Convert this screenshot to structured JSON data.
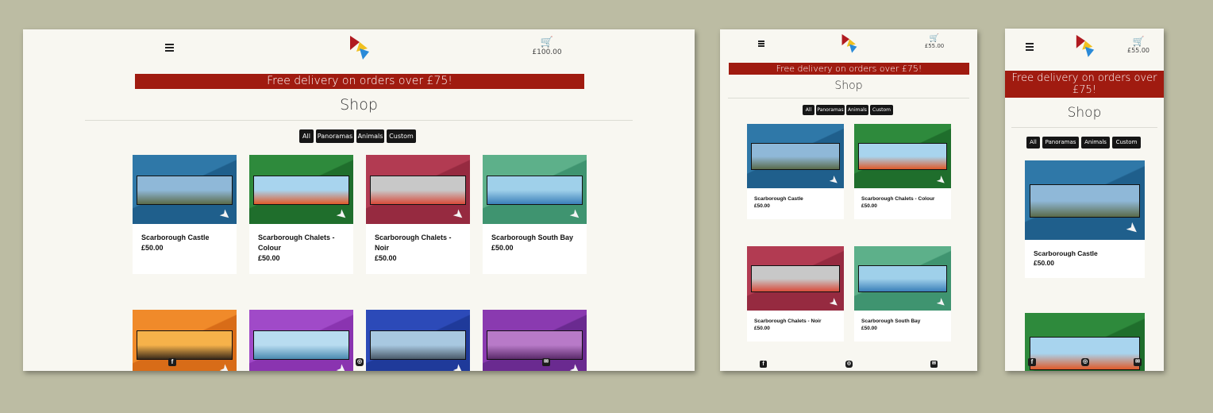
{
  "brand": {
    "logo_name": "kw-artwork-logo"
  },
  "screens": [
    {
      "id": "desktop",
      "cart_total": "£100.00",
      "banner": "Free delivery on orders over £75!",
      "title": "Shop",
      "filters": [
        "All",
        "Panoramas",
        "Animals",
        "Custom"
      ],
      "products": [
        {
          "name": "Scarborough Castle",
          "price": "£50.00",
          "bg": "#2f78a8",
          "bg2": "#1f5f8c",
          "pano_top": "#8fb8d8",
          "pano_bottom": "#5a6b4a"
        },
        {
          "name": "Scarborough Chalets - Colour",
          "price": "£50.00",
          "bg": "#2e8a3c",
          "bg2": "#1f6e2c",
          "pano_top": "#a8d4ee",
          "pano_bottom": "#e05a2a"
        },
        {
          "name": "Scarborough Chalets - Noir",
          "price": "£50.00",
          "bg": "#b23b52",
          "bg2": "#962a40",
          "pano_top": "#c8c8c8",
          "pano_bottom": "#d84a3a"
        },
        {
          "name": "Scarborough South Bay",
          "price": "£50.00",
          "bg": "#5db08a",
          "bg2": "#3f9470",
          "pano_top": "#9fd0ea",
          "pano_bottom": "#3a7fb8"
        },
        {
          "name": "",
          "price": "",
          "bg": "#f08a2a",
          "bg2": "#d86c18",
          "pano_top": "#f6b24a",
          "pano_bottom": "#3a2a1a"
        },
        {
          "name": "",
          "price": "",
          "bg": "#a04ac8",
          "bg2": "#8a34b0",
          "pano_top": "#b8dcf0",
          "pano_bottom": "#4a8ab0"
        },
        {
          "name": "",
          "price": "",
          "bg": "#2c4ab8",
          "bg2": "#1f3a9a",
          "pano_top": "#a8c8e0",
          "pano_bottom": "#4a5a6a"
        },
        {
          "name": "",
          "price": "",
          "bg": "#8a3ab0",
          "bg2": "#6a2a90",
          "pano_top": "#b87ac8",
          "pano_bottom": "#5a2a6a"
        }
      ]
    },
    {
      "id": "tablet",
      "cart_total": "£55.00",
      "banner": "Free delivery on orders over £75!",
      "title": "Shop",
      "filters": [
        "All",
        "Panoramas",
        "Animals",
        "Custom"
      ],
      "products": [
        {
          "name": "Scarborough Castle",
          "price": "£50.00",
          "bg": "#2f78a8",
          "bg2": "#1f5f8c",
          "pano_top": "#8fb8d8",
          "pano_bottom": "#5a6b4a"
        },
        {
          "name": "Scarborough Chalets - Colour",
          "price": "£50.00",
          "bg": "#2e8a3c",
          "bg2": "#1f6e2c",
          "pano_top": "#a8d4ee",
          "pano_bottom": "#e05a2a"
        },
        {
          "name": "Scarborough Chalets - Noir",
          "price": "£50.00",
          "bg": "#b23b52",
          "bg2": "#962a40",
          "pano_top": "#c8c8c8",
          "pano_bottom": "#d84a3a"
        },
        {
          "name": "Scarborough South Bay",
          "price": "£50.00",
          "bg": "#5db08a",
          "bg2": "#3f9470",
          "pano_top": "#9fd0ea",
          "pano_bottom": "#3a7fb8"
        }
      ]
    },
    {
      "id": "mobile",
      "cart_total": "£55.00",
      "banner": "Free delivery on orders over £75!",
      "title": "Shop",
      "filters": [
        "All",
        "Panoramas",
        "Animals",
        "Custom"
      ],
      "products": [
        {
          "name": "Scarborough Castle",
          "price": "£50.00",
          "bg": "#2f78a8",
          "bg2": "#1f5f8c",
          "pano_top": "#8fb8d8",
          "pano_bottom": "#5a6b4a"
        },
        {
          "name": "",
          "price": "",
          "bg": "#2e8a3c",
          "bg2": "#1f6e2c",
          "pano_top": "#a8d4ee",
          "pano_bottom": "#e05a2a"
        }
      ]
    }
  ],
  "footer": {
    "icons": [
      "facebook-icon",
      "instagram-icon",
      "email-icon"
    ]
  },
  "colors": {
    "banner": "#a01b10",
    "page_bg": "#f8f7f1",
    "backdrop": "#bcbca3",
    "filter_button": "#161616"
  }
}
